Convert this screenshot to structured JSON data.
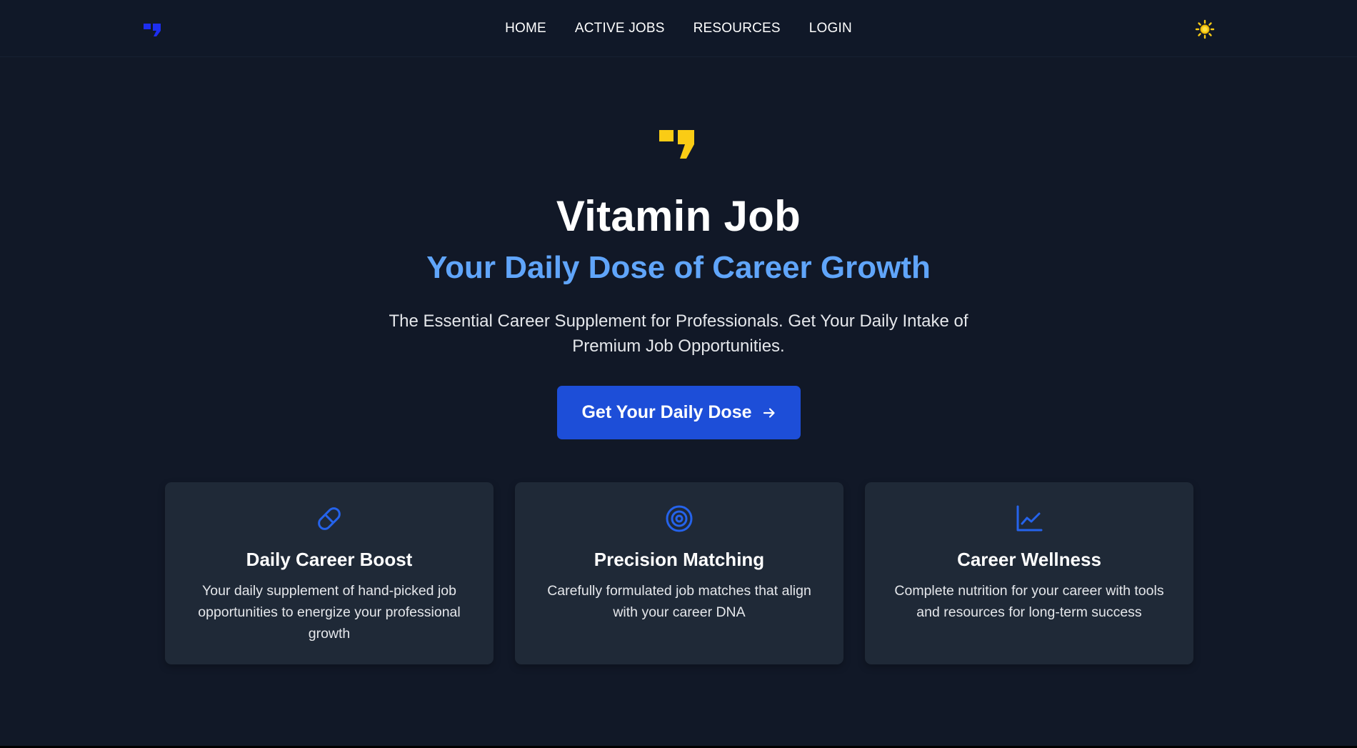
{
  "colors": {
    "background": "#111827",
    "nav_background": "#101828",
    "card_background": "#1f2937",
    "accent_blue": "#1d4ed8",
    "subtitle_blue": "#60a5fa",
    "logo_yellow": "#facc15",
    "nav_logo_blue": "#1d2ef0"
  },
  "nav": {
    "logo_icon": "quote-mark-logo-icon",
    "links": [
      "HOME",
      "ACTIVE JOBS",
      "RESOURCES",
      "LOGIN"
    ],
    "theme_toggle_icon": "sun-icon"
  },
  "hero": {
    "logo_icon": "quote-mark-logo-icon",
    "title": "Vitamin Job",
    "subtitle": "Your Daily Dose of Career Growth",
    "description": "The Essential Career Supplement for Professionals. Get Your Daily Intake of Premium Job Opportunities.",
    "cta_label": "Get Your Daily Dose",
    "cta_icon": "arrow-right-icon"
  },
  "features": [
    {
      "icon": "pill-icon",
      "title": "Daily Career Boost",
      "text": "Your daily supplement of hand-picked job opportunities to energize your professional growth"
    },
    {
      "icon": "target-icon",
      "title": "Precision Matching",
      "text": "Carefully formulated job matches that align with your career DNA"
    },
    {
      "icon": "line-chart-icon",
      "title": "Career Wellness",
      "text": "Complete nutrition for your career with tools and resources for long-term success"
    }
  ]
}
